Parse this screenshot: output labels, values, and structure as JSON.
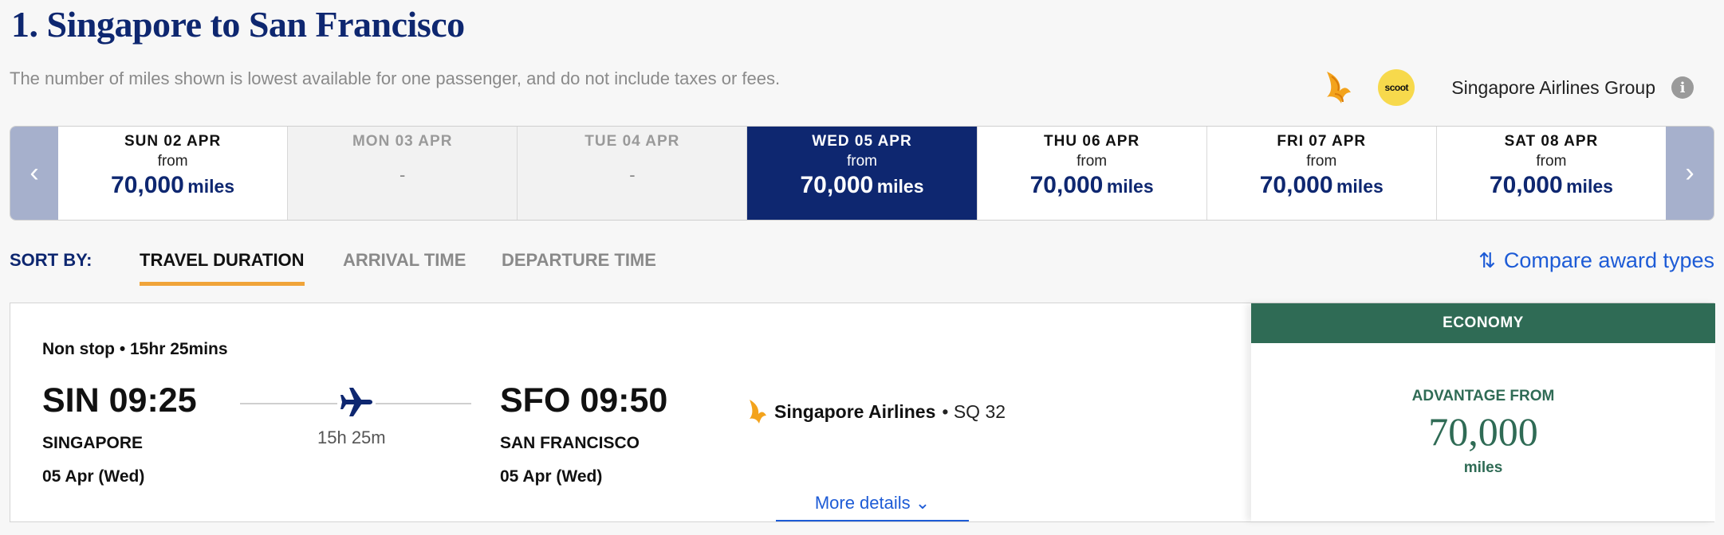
{
  "header": {
    "title": "1. Singapore to San Francisco",
    "subtitle": "The number of miles shown is lowest available for one passenger, and do not include taxes or fees.",
    "scoot_logo_text": "scoot",
    "group_label": "Singapore Airlines Group",
    "info_glyph": "i"
  },
  "date_nav": {
    "prev_glyph": "‹",
    "next_glyph": "›",
    "dates": [
      {
        "day": "SUN 02 APR",
        "from": "from",
        "price": "70,000",
        "unit": "miles",
        "state": "available"
      },
      {
        "day": "MON 03 APR",
        "dash": "-",
        "state": "disabled"
      },
      {
        "day": "TUE 04 APR",
        "dash": "-",
        "state": "disabled"
      },
      {
        "day": "WED 05 APR",
        "from": "from",
        "price": "70,000",
        "unit": "miles",
        "state": "selected"
      },
      {
        "day": "THU 06 APR",
        "from": "from",
        "price": "70,000",
        "unit": "miles",
        "state": "available"
      },
      {
        "day": "FRI 07 APR",
        "from": "from",
        "price": "70,000",
        "unit": "miles",
        "state": "available"
      },
      {
        "day": "SAT 08 APR",
        "from": "from",
        "price": "70,000",
        "unit": "miles",
        "state": "available"
      }
    ]
  },
  "sort": {
    "label": "SORT BY:",
    "tabs": [
      "TRAVEL DURATION",
      "ARRIVAL TIME",
      "DEPARTURE TIME"
    ],
    "active": "TRAVEL DURATION",
    "compare_glyph": "⇅",
    "compare_label": "Compare award types"
  },
  "flight": {
    "stop_info": "Non stop • 15hr 25mins",
    "origin": {
      "code_time": "SIN 09:25",
      "city": "SINGAPORE",
      "date": "05 Apr (Wed)"
    },
    "destination": {
      "code_time": "SFO 09:50",
      "city": "SAN FRANCISCO",
      "date": "05 Apr (Wed)"
    },
    "duration": "15h 25m",
    "airline_name": "Singapore Airlines",
    "flight_number": "• SQ 32",
    "more_details": "More details ⌄"
  },
  "fare": {
    "cabin": "ECONOMY",
    "label": "ADVANTAGE FROM",
    "price": "70,000",
    "unit": "miles"
  },
  "colors": {
    "brand_navy": "#0e2770",
    "economy_green": "#2f6b55",
    "link_blue": "#1d5bd6",
    "sort_underline": "#f0a43a"
  }
}
